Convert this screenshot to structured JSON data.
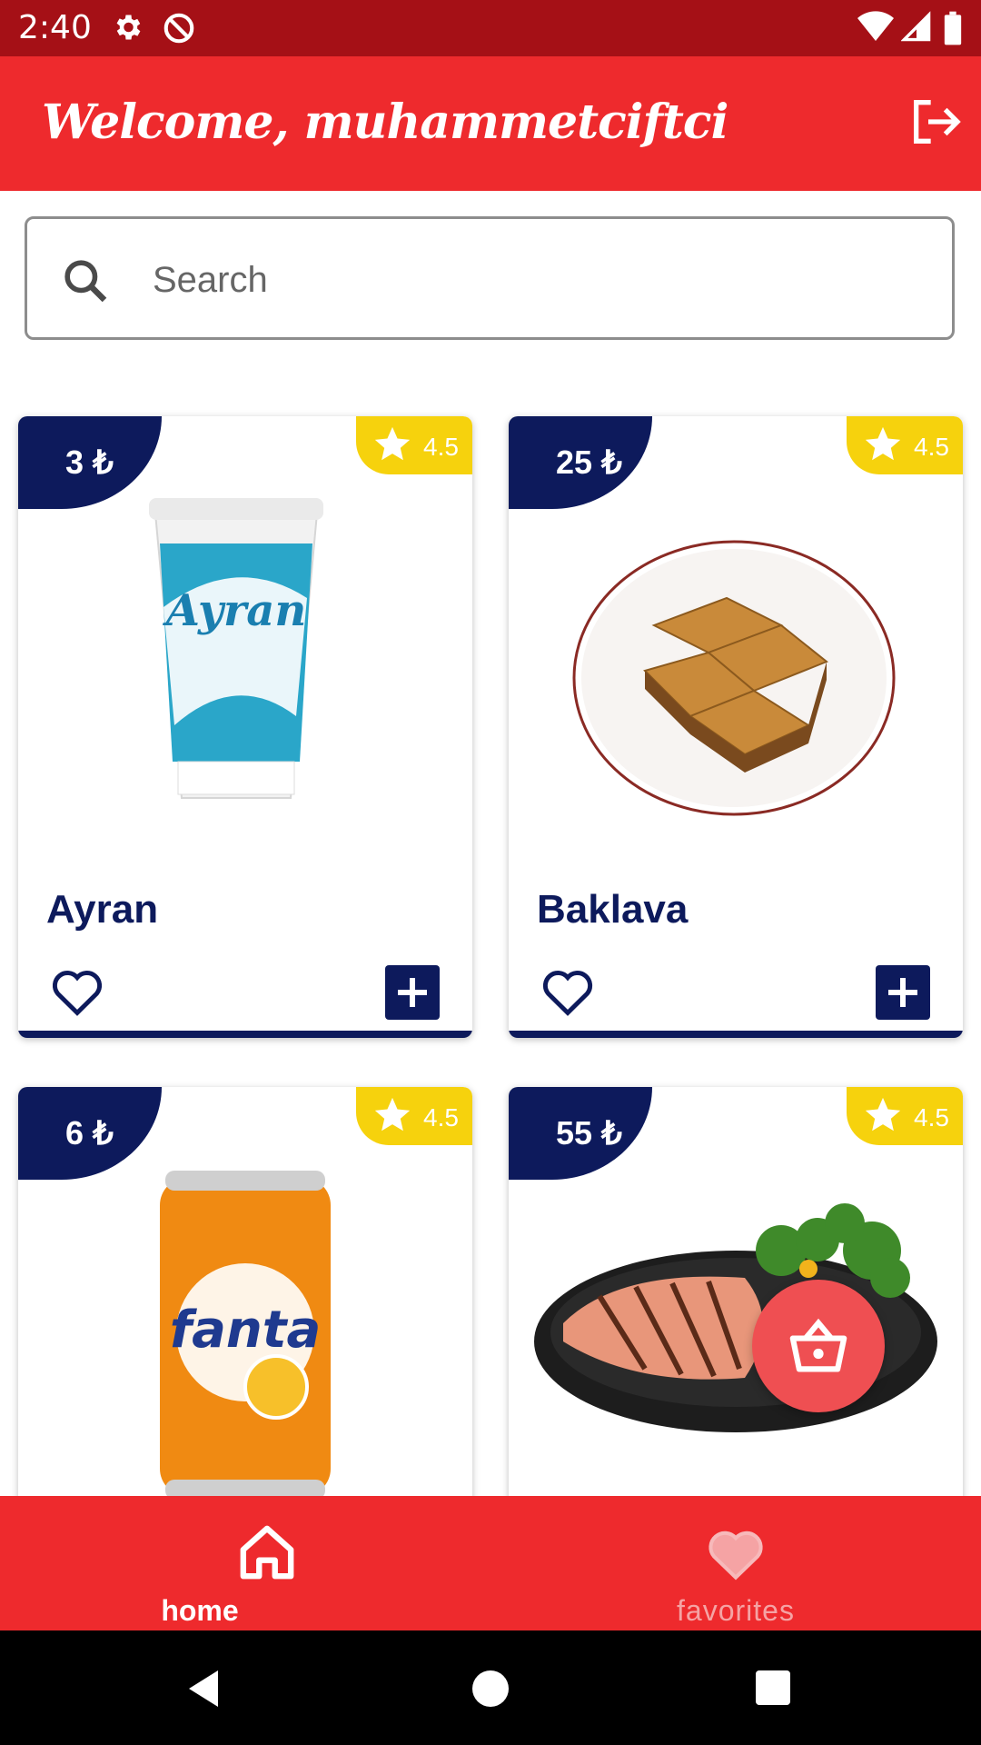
{
  "status_bar": {
    "time": "2:40"
  },
  "app_bar": {
    "title": "Welcome, muhammetciftci"
  },
  "search": {
    "placeholder": "Search"
  },
  "products": [
    {
      "price": "3 ₺",
      "rating": "4.5",
      "name": "Ayran"
    },
    {
      "price": "25 ₺",
      "rating": "4.5",
      "name": "Baklava"
    },
    {
      "price": "6 ₺",
      "rating": "4.5",
      "name": ""
    },
    {
      "price": "55 ₺",
      "rating": "4.5",
      "name": ""
    }
  ],
  "bottom_nav": {
    "home_label": "home",
    "favorites_label": "favorites"
  },
  "colors": {
    "brand_red": "#ee2a2d",
    "status_red": "#a51016",
    "navy": "#0d1a5c",
    "rating_yellow": "#f6d20d",
    "fab_red": "#ef4f52"
  },
  "icons": [
    "gear-icon",
    "do-not-disturb-icon",
    "wifi-icon",
    "signal-icon",
    "battery-icon",
    "logout-icon",
    "search-icon",
    "star-icon",
    "heart-icon",
    "add-icon",
    "basket-icon",
    "home-icon",
    "back-icon",
    "circle-home-icon",
    "square-recents-icon"
  ]
}
